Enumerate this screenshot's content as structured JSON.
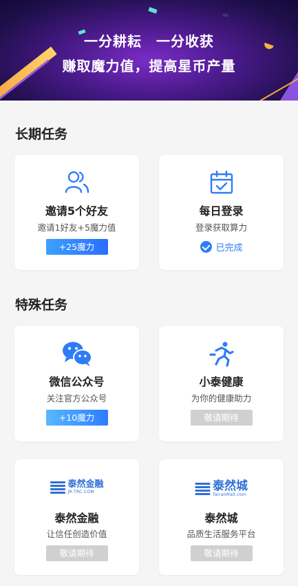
{
  "banner": {
    "line1": "一分耕耘　一分收获",
    "line2": "赚取魔力值，提高星币产量"
  },
  "sections": {
    "long_term": "长期任务",
    "special": "特殊任务"
  },
  "long_tasks": [
    {
      "title": "邀请5个好友",
      "desc": "邀请1好友+5魔力值",
      "action": "+25魔力",
      "icon": "people-icon"
    },
    {
      "title": "每日登录",
      "desc": "登录获取算力",
      "status": "已完成",
      "icon": "calendar-check-icon"
    }
  ],
  "special_tasks": [
    {
      "title": "微信公众号",
      "desc": "关注官方公众号",
      "action": "+10魔力",
      "icon": "wechat-icon"
    },
    {
      "title": "小泰健康",
      "desc": "为你的健康助力",
      "action": "敬请期待",
      "icon": "running-icon"
    },
    {
      "title": "泰然金融",
      "desc": "让信任创造价值",
      "action": "敬请期待",
      "logo_name": "泰然金融",
      "logo_sub": "JR.TRC.COM"
    },
    {
      "title": "泰然城",
      "desc": "品质生活服务平台",
      "action": "敬请期待",
      "logo_name": "泰然城",
      "logo_sub": "TairanMall.com"
    }
  ],
  "colors": {
    "accent": "#2f7cf6",
    "pending": "#d0d0d0",
    "banner_purple": "#4a1a8a"
  }
}
